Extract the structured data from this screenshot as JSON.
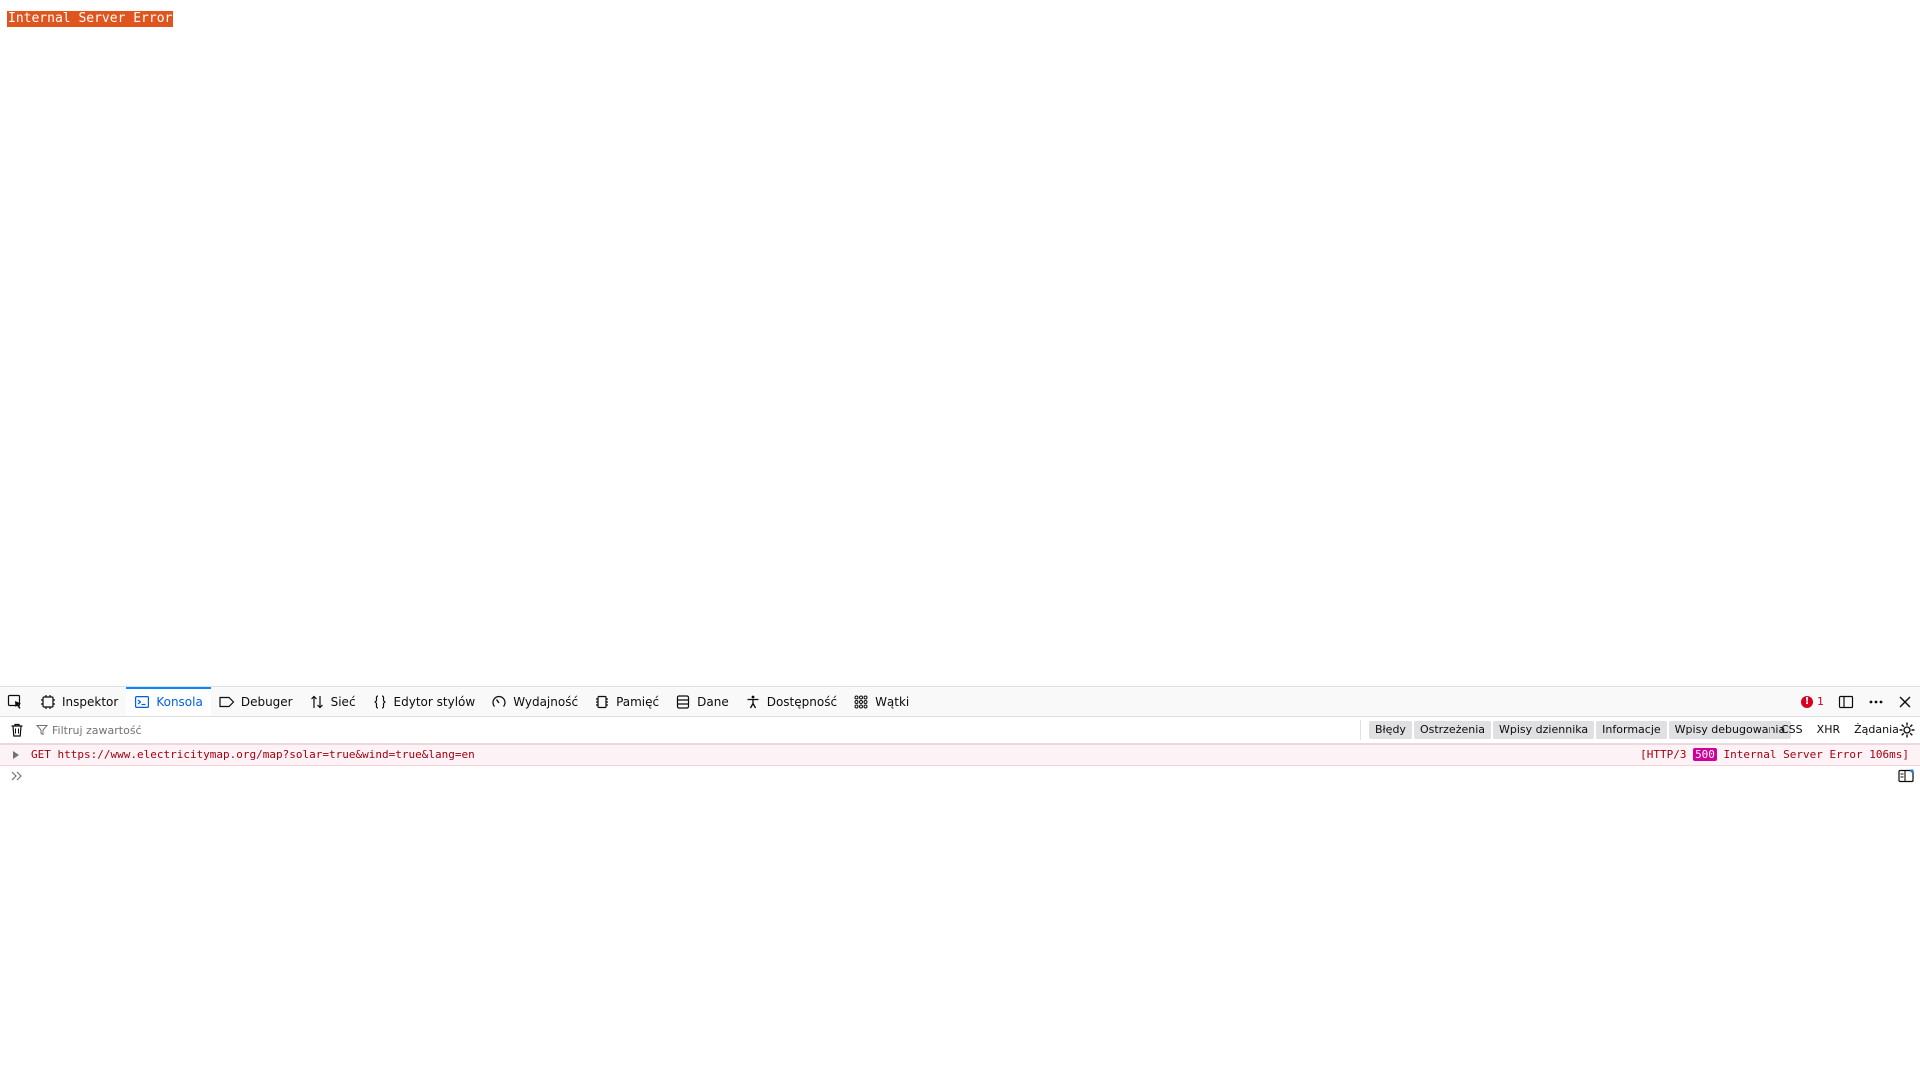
{
  "page": {
    "error_text": "Internal Server Error"
  },
  "devtools": {
    "tabs": [
      {
        "label": "Inspektor",
        "icon": "inspector-icon"
      },
      {
        "label": "Konsola",
        "icon": "console-icon",
        "selected": true
      },
      {
        "label": "Debuger",
        "icon": "debugger-icon"
      },
      {
        "label": "Sieć",
        "icon": "network-icon"
      },
      {
        "label": "Edytor stylów",
        "icon": "style-editor-icon"
      },
      {
        "label": "Wydajność",
        "icon": "performance-icon"
      },
      {
        "label": "Pamięć",
        "icon": "memory-icon"
      },
      {
        "label": "Dane",
        "icon": "storage-icon"
      },
      {
        "label": "Dostępność",
        "icon": "accessibility-icon"
      },
      {
        "label": "Wątki",
        "icon": "workers-icon"
      }
    ],
    "error_count": "1",
    "filter": {
      "placeholder": "Filtruj zawartość"
    },
    "levels": [
      "Błędy",
      "Ostrzeżenia",
      "Wpisy dziennika",
      "Informacje",
      "Wpisy debugowania"
    ],
    "types": [
      "CSS",
      "XHR",
      "Żądania"
    ],
    "message": {
      "text": "GET https://www.electricitymap.org/map?solar=true&wind=true&lang=en",
      "status_prefix": "[HTTP/3 ",
      "status_code": "500",
      "status_suffix": " Internal Server Error 106ms]"
    },
    "colors": {
      "error": "#a4000f",
      "accent": "#0060df",
      "status_badge": "#d1009c",
      "page_error_bg": "#e0541e"
    }
  }
}
